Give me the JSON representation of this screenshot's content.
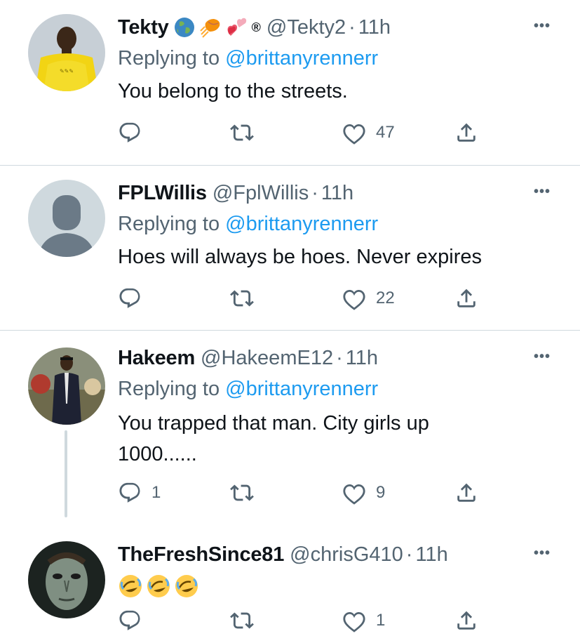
{
  "tweets": [
    {
      "name": "Tekty",
      "handle": "@Tekty2",
      "dot": "·",
      "time": "11h",
      "badges": [
        "globe-emoji",
        "basketball-emoji",
        "two-hearts-emoji"
      ],
      "registered": "®",
      "replying_prefix": "Replying to ",
      "replying_to": "@brittanyrennerr",
      "text": "You belong to the streets.",
      "replies": "",
      "retweets": "",
      "likes": "47",
      "avatar": "yellow-shirt-avatar"
    },
    {
      "name": "FPLWillis",
      "handle": "@FplWillis",
      "dot": "·",
      "time": "11h",
      "replying_prefix": "Replying to ",
      "replying_to": "@brittanyrennerr",
      "text": "Hoes will always be hoes. Never expires",
      "replies": "",
      "retweets": "",
      "likes": "22",
      "avatar": "default-profile-avatar"
    },
    {
      "name": "Hakeem",
      "handle": "@HakeemE12",
      "dot": "·",
      "time": "11h",
      "replying_prefix": "Replying to ",
      "replying_to": "@brittanyrennerr",
      "text": "You trapped that man. City girls up 1000......",
      "replies": "1",
      "retweets": "",
      "likes": "9",
      "avatar": "suit-man-avatar"
    },
    {
      "name": "TheFreshSince81",
      "handle": "@chrisG410",
      "dot": "·",
      "time": "11h",
      "text_emojis": [
        "rolling-laughing-emoji",
        "rolling-laughing-emoji",
        "rolling-laughing-emoji"
      ],
      "replies": "",
      "retweets": "",
      "likes": "1",
      "avatar": "masked-face-avatar"
    }
  ],
  "more_label": "•••",
  "colors": {
    "text": "#0f1419",
    "secondary": "#536471",
    "link": "#1d9bf0",
    "divider": "#cfd9de"
  }
}
